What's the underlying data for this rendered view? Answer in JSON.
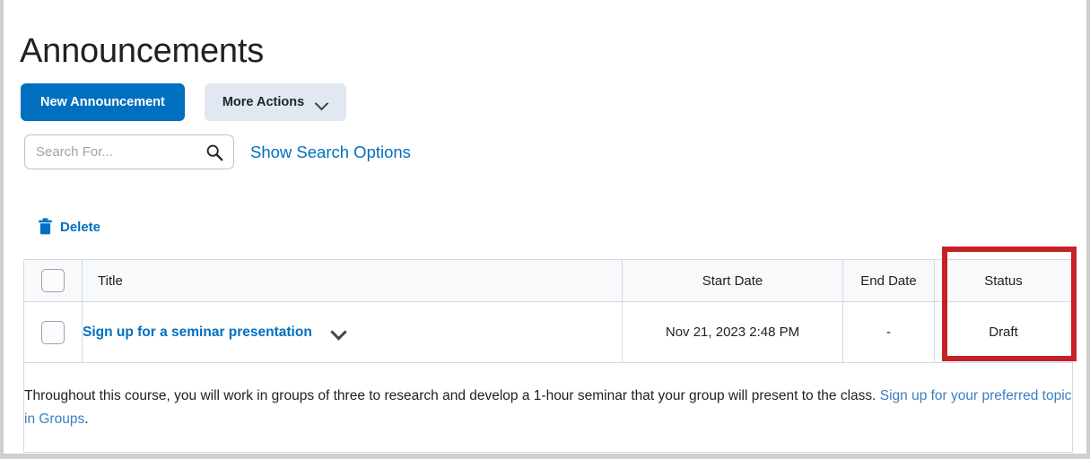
{
  "page": {
    "title": "Announcements"
  },
  "toolbar": {
    "new_announcement_label": "New Announcement",
    "more_actions_label": "More Actions",
    "more_actions_icon": "chevron-down-icon"
  },
  "search": {
    "value": "",
    "placeholder": "Search For...",
    "icon": "search-icon",
    "show_search_options_label": "Show Search Options"
  },
  "actions": {
    "delete_label": "Delete",
    "delete_icon": "trash-icon"
  },
  "table": {
    "columns": [
      {
        "key": "select",
        "label": ""
      },
      {
        "key": "title",
        "label": "Title"
      },
      {
        "key": "start_date",
        "label": "Start Date"
      },
      {
        "key": "end_date",
        "label": "End Date"
      },
      {
        "key": "status",
        "label": "Status"
      }
    ],
    "rows": [
      {
        "title": "Sign up for a seminar presentation",
        "title_menu_icon": "chevron-down-icon",
        "start_date": "Nov 21, 2023 2:48 PM",
        "end_date": "-",
        "status": "Draft",
        "description_part1": "Throughout this course, you will work in groups of three to research and develop a 1-hour seminar that your group will present to the class. ",
        "description_link": "Sign up for your preferred topic in Groups",
        "description_part2": "."
      }
    ]
  },
  "annotation": {
    "highlight_target": "status-column",
    "color": "#C62128"
  },
  "colors": {
    "primary_blue": "#006FBF",
    "secondary_button_bg": "#E2E8F1",
    "link_blue": "#3A7FC1",
    "header_row_bg": "#F8F9FB",
    "border_grey": "#D3DAE2",
    "annotation_red": "#C62128"
  }
}
